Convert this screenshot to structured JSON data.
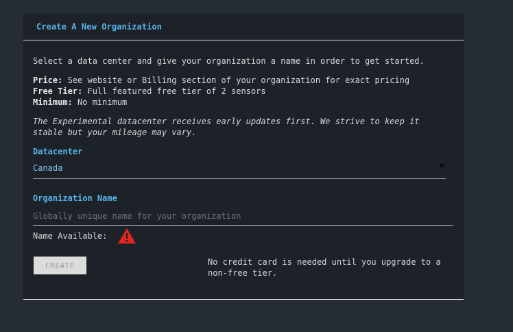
{
  "card": {
    "title": "Create A New Organization",
    "intro": "Select a data center and give your organization a name in order to get started.",
    "price_label": "Price:",
    "price_text": "See website or Billing section of your organization for exact pricing",
    "free_tier_label": "Free Tier:",
    "free_tier_text": "Full featured free tier of 2 sensors",
    "minimum_label": "Minimum:",
    "minimum_text": "No minimum",
    "experimental_line1": "The Experimental datacenter receives early updates first. We strive to keep it",
    "experimental_line2": "stable but your mileage may vary."
  },
  "datacenter": {
    "label": "Datacenter",
    "selected": "Canada",
    "caret_icon": "triangle-down"
  },
  "org_name": {
    "label": "Organization Name",
    "value": "",
    "placeholder": "Globally unique name for your organization",
    "availability_label": "Name Available:",
    "availability_icon": "warning-triangle",
    "warning_color": "#e5261e"
  },
  "actions": {
    "create_label": "CREATE",
    "note": "No credit card is needed until you upgrade to a non-free tier."
  }
}
